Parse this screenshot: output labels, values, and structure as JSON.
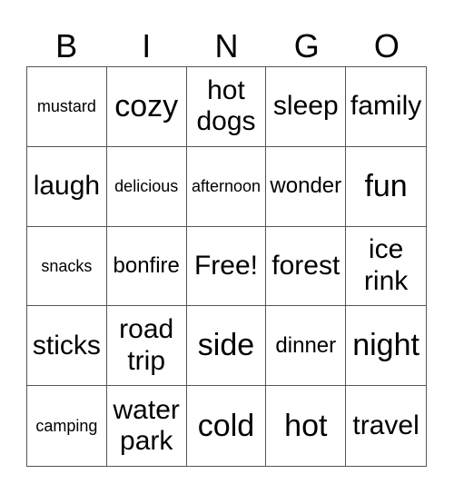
{
  "header": [
    "B",
    "I",
    "N",
    "G",
    "O"
  ],
  "cells": [
    [
      "mustard",
      "cozy",
      "hot dogs",
      "sleep",
      "family"
    ],
    [
      "laugh",
      "delicious",
      "afternoon",
      "wonder",
      "fun"
    ],
    [
      "snacks",
      "bonfire",
      "Free!",
      "forest",
      "ice rink"
    ],
    [
      "sticks",
      "road trip",
      "side",
      "dinner",
      "night"
    ],
    [
      "camping",
      "water park",
      "cold",
      "hot",
      "travel"
    ]
  ]
}
